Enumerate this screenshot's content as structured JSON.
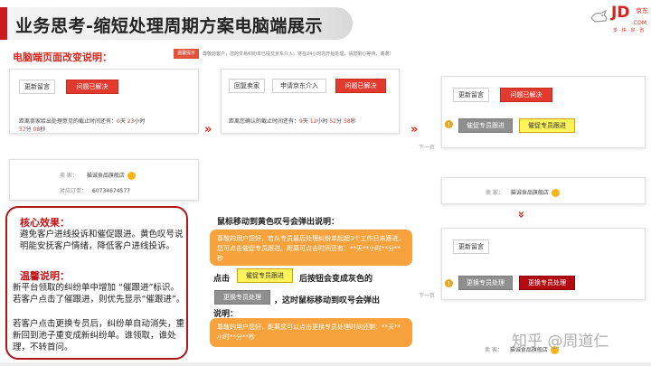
{
  "header": {
    "title": "业务思考-缩短处理周期方案电脑端展示",
    "logo_text": "JD",
    "logo_domain": ".COM",
    "logo_brand": "京东",
    "logo_slogan": "多 · 快 · 好 · 省"
  },
  "section": {
    "heading": "电脑端页面改变说明：",
    "notice_tag": "温馨提示",
    "notice_text": "尊敬的客户，您的交易纠纷单已提交京东介入，将在24小时内开始处理，请您耐心等待，谢谢！"
  },
  "panel1": {
    "btn_modify": "更新留言",
    "btn_resolved": "问题已解决",
    "deadline_prefix": "距离卖家给出处理意见的截止时间还有：",
    "deadline_d": "0",
    "deadline_d_unit": "天",
    "deadline_h": "23",
    "deadline_h_unit": "小时",
    "deadline_m": "57",
    "deadline_m_unit": "分",
    "deadline_s": "08",
    "deadline_s_unit": "秒",
    "seller_label": "卖 家：",
    "seller_name": "猫诚食品旗舰店",
    "order_label": "对应订单：",
    "order_no": "60734674577"
  },
  "panel2": {
    "btn_reply": "回复卖家",
    "btn_apply": "申请京东介入",
    "btn_resolved": "问题已解决",
    "deadline_prefix": "距离您确认的截止时间还有：",
    "deadline_d": "9",
    "deadline_d_unit": "天",
    "deadline_h": "12",
    "deadline_h_unit": "小时",
    "deadline_m": "52",
    "deadline_m_unit": "分",
    "deadline_s": "58",
    "deadline_s_unit": "秒"
  },
  "panel3": {
    "btn_modify": "更新留言",
    "btn_resolved": "问题已解决",
    "btn_urge_gray": "催促专员跟进",
    "btn_urge_yellow": "催促专员跟进",
    "next_page": "下一页"
  },
  "panel4": {
    "seller_label": "卖 家：",
    "seller_name": "猫诚食品旗舰店"
  },
  "panel5": {
    "btn_modify": "更新留言",
    "btn_change_gray": "更换专员处理",
    "btn_change_red": "更换专员处理",
    "next_page": "下一页"
  },
  "core": {
    "title1": "核心效果：",
    "text1": "避免客户进线投诉和催促跟进。黄色叹号说明能安抚客户情绪，降低客户进线投诉。",
    "title2": "温馨说明：",
    "text2": "新平台领取的纠纷单中增加 “催跟进”标识。若客户点击了催跟进，则优先显示“催跟进”。",
    "text3": "若客户点击更换专员后，纠纷单自动消失，重新回到池子重变成新纠纷单。谁领取，谁处理，不转首问。"
  },
  "middle": {
    "hover_title": "鼠标移动到黄色叹号会弹出说明：",
    "hover_text": "尊敬的用户您好，若从专员最后处理纠纷单起超3个工作日未跟进，您可点击催促专员跟进。距离可点击时间还有：**天**小时**分**秒",
    "click_prefix": "点击",
    "click_btn": "催促专员跟进",
    "click_suffix": "后按钮会变成灰色的",
    "change_btn": "更换专员处理",
    "hover2_suffix": "，这时鼠标移动到叹号会弹出",
    "hover2_tail": "说明：",
    "hover2_text": "尊敬的用户您好，距离您可以点击更换专员处理时间还剩：**天**小时**分**秒"
  },
  "watermark": "知乎 @周道仁",
  "colors": {
    "accent_red": "#d9251d",
    "orange": "#f7a23c",
    "yellow_btn": "#fff35a"
  }
}
